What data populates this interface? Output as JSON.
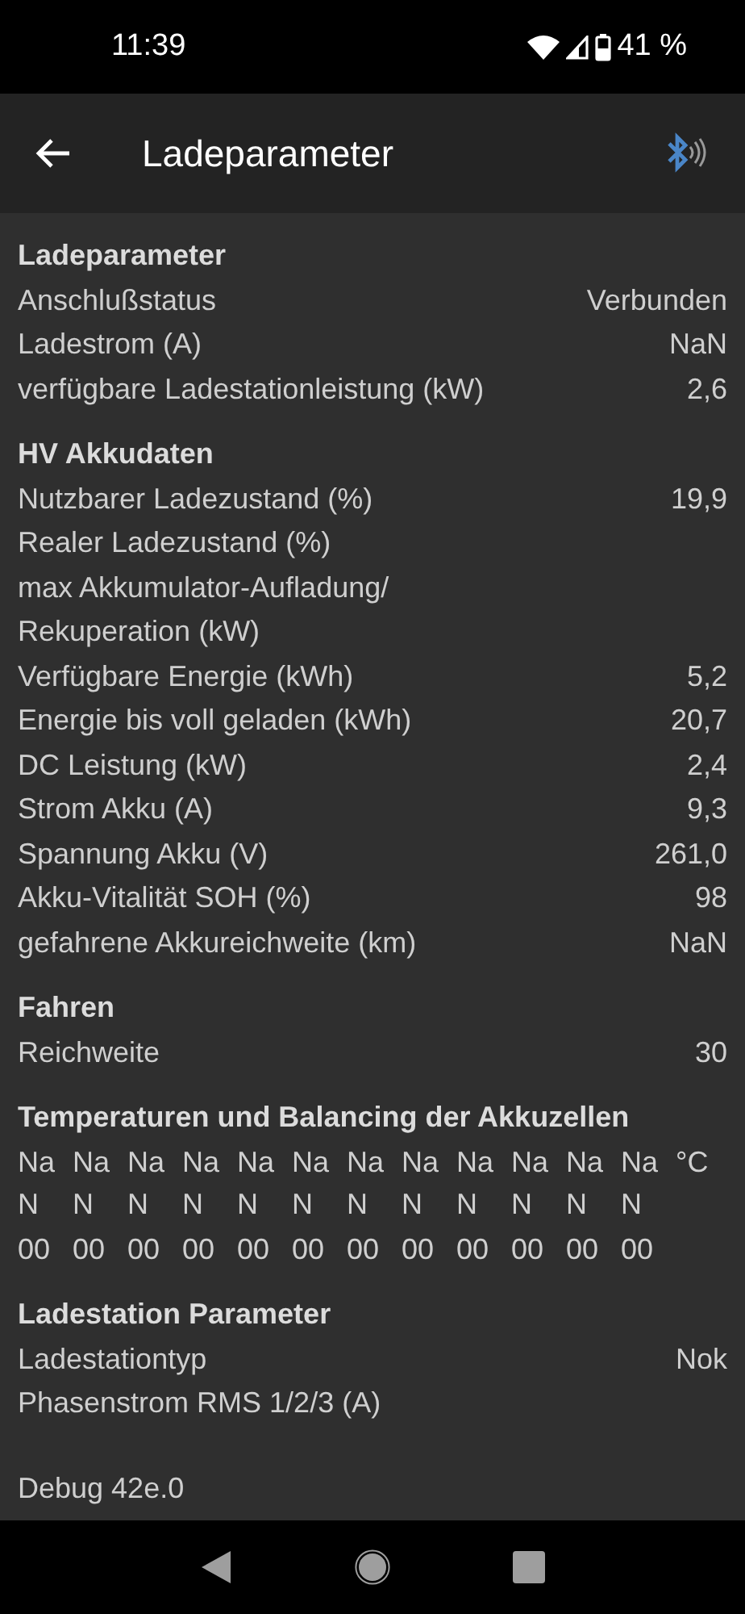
{
  "status_bar": {
    "time": "11:39",
    "battery": "41 %"
  },
  "app_bar": {
    "title": "Ladeparameter"
  },
  "sections": [
    {
      "kind": "rows",
      "title": "Ladeparameter",
      "rows": [
        {
          "label": "Anschlußstatus",
          "value": "Verbunden"
        },
        {
          "label": "Ladestrom (A)",
          "value": "NaN"
        },
        {
          "label": "verfügbare Ladestationleistung (kW)",
          "value": "2,6"
        }
      ]
    },
    {
      "kind": "rows",
      "title": "HV Akkudaten",
      "rows": [
        {
          "label": "Nutzbarer Ladezustand (%)",
          "value": "19,9"
        },
        {
          "label": "Realer Ladezustand (%)"
        },
        {
          "label": "max Akkumulator-Aufladung/ Rekuperation (kW)"
        },
        {
          "label": "Verfügbare Energie (kWh)",
          "value": "5,2"
        },
        {
          "label": "Energie bis voll geladen (kWh)",
          "value": "20,7"
        },
        {
          "label": "DC Leistung (kW)",
          "value": "2,4"
        },
        {
          "label": "Strom Akku (A)",
          "value": "9,3"
        },
        {
          "label": "Spannung Akku (V)",
          "value": "261,0"
        },
        {
          "label": "Akku-Vitalität SOH (%)",
          "value": "98"
        },
        {
          "label": "gefahrene Akkureichweite (km)",
          "value": "NaN"
        }
      ]
    },
    {
      "kind": "rows",
      "title": "Fahren",
      "rows": [
        {
          "label": "Reichweite",
          "value": "30"
        }
      ]
    },
    {
      "kind": "cells",
      "title": "Temperaturen und Balancing der Akkuzellen",
      "temperatures": [
        "NaN",
        "NaN",
        "NaN",
        "NaN",
        "NaN",
        "NaN",
        "NaN",
        "NaN",
        "NaN",
        "NaN",
        "NaN",
        "NaN"
      ],
      "unit": "°C",
      "balancing": [
        "00",
        "00",
        "00",
        "00",
        "00",
        "00",
        "00",
        "00",
        "00",
        "00",
        "00",
        "00"
      ]
    },
    {
      "kind": "rows",
      "title": "Ladestation Parameter",
      "rows": [
        {
          "label": "Ladestationtyp",
          "value": "Nok"
        },
        {
          "label": "Phasenstrom RMS 1/2/3 (A)"
        }
      ]
    }
  ],
  "footer": "Debug 42e.0"
}
